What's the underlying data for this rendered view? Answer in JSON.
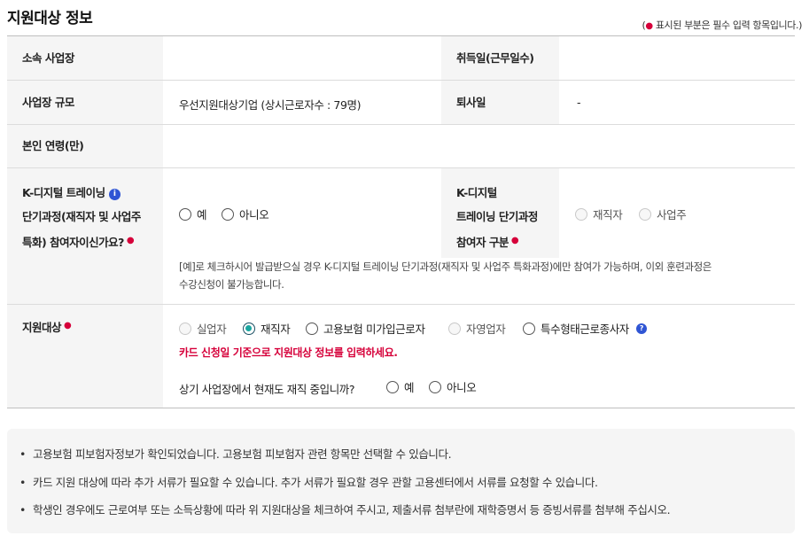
{
  "header": {
    "title": "지원대상 정보",
    "required_note_prefix": "(",
    "required_note_dot": "●",
    "required_note_text": " 표시된 부분은 필수 입력 항목입니다.)"
  },
  "rows": {
    "workplace": {
      "label": "소속 사업장",
      "value": ""
    },
    "acquisition_date": {
      "label": "취득일(근무일수)",
      "value": ""
    },
    "workplace_size": {
      "label": "사업장 규모",
      "value": "우선지원대상기업 (상시근로자수 : 79명)"
    },
    "resignation_date": {
      "label": "퇴사일",
      "value": "-"
    },
    "age": {
      "label": "본인 연령(만)",
      "value": ""
    },
    "kdigital": {
      "label_line1": "K-디지털 트레이닝",
      "label_line2": "단기과정(재직자 및 사업주",
      "label_line3": "특화) 참여자이신가요?",
      "info_icon": "i",
      "options": [
        "예",
        "아니오"
      ],
      "right_label_line1": "K-디지털",
      "right_label_line2": "트레이닝 단기과정",
      "right_label_line3": "참여자 구분",
      "right_options": [
        "재직자",
        "사업주"
      ],
      "note_line1": "[예]로 체크하시어 발급받으실 경우 K-디지털 트레이닝 단기과정(재직자 및 사업주 특화과정)에만 참여가 가능하며, 이외 훈련과정은",
      "note_line2": "수강신청이 불가능합니다."
    },
    "target": {
      "label": "지원대상",
      "options": [
        "실업자",
        "재직자",
        "고용보험 미가입근로자",
        "자영업자",
        "특수형태근로종사자"
      ],
      "selected": "재직자",
      "q_icon": "?",
      "warning": "카드 신청일 기준으로 지원대상 정보를 입력하세요.",
      "question": "상기 사업장에서 현재도 재직 중입니까?",
      "question_options": [
        "예",
        "아니오"
      ]
    },
    "required_dot": "●"
  },
  "notices": [
    "고용보험 피보험자정보가 확인되었습니다. 고용보험 피보험자 관련 항목만 선택할 수 있습니다.",
    "카드 지원 대상에 따라 추가 서류가 필요할 수 있습니다. 추가 서류가 필요할 경우 관할 고용센터에서 서류를 요청할 수 있습니다.",
    "학생인 경우에도 근로여부 또는 소득상황에 따라 위 지원대상을 체크하여 주시고, 제출서류 첨부란에 재학증명서 등 증빙서류를 첨부해 주십시오."
  ],
  "notice_bullet": "•",
  "colors": {
    "required": "#d6003a",
    "checked": "#1aa6a0",
    "info": "#2f55d4"
  }
}
